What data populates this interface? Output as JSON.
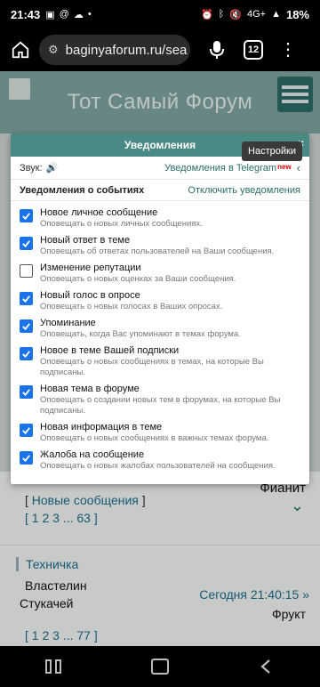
{
  "status": {
    "time": "21:43",
    "battery": "18%",
    "net": "4G+"
  },
  "browser": {
    "url": "baginyaforum.ru/sea",
    "tab_count": "12"
  },
  "forum": {
    "title": "Тот Самый Форум"
  },
  "popup": {
    "title": "Уведомления",
    "close": "×",
    "tooltip": "Настройки",
    "sound_label": "Звук:",
    "telegram_link": "Уведомления в Telegram",
    "new_badge": "new",
    "section_title": "Уведомления о событиях",
    "disable_link": "Отключить уведомления",
    "items": [
      {
        "title": "Новое личное сообщение",
        "desc": "Оповещать о новых личных сообщениях.",
        "checked": true
      },
      {
        "title": "Новый ответ в теме",
        "desc": "Оповещать об ответах пользователей на Ваши сообщения.",
        "checked": true
      },
      {
        "title": "Изменение репутации",
        "desc": "Оповещать о новых оценках за Ваши сообщения.",
        "checked": false
      },
      {
        "title": "Новый голос в опросе",
        "desc": "Оповещать о новых голосах в Ваших опросах.",
        "checked": true
      },
      {
        "title": "Упоминание",
        "desc": "Оповещать, когда Вас упоминают в темах форума.",
        "checked": true
      },
      {
        "title": "Новое в теме Вашей подписки",
        "desc": "Оповещать о новых сообщениях в темах, на которые Вы подписаны.",
        "checked": true
      },
      {
        "title": "Новая тема в форуме",
        "desc": "Оповещать о создании новых тем в форумах, на которые Вы подписаны.",
        "checked": true
      },
      {
        "title": "Новая информация в теме",
        "desc": "Оповещать о новых сообщениях в важных темах форума.",
        "checked": true
      },
      {
        "title": "Жалоба на сообщение",
        "desc": "Оповещать о новых жалобах пользователей на сообщения.",
        "checked": true
      }
    ]
  },
  "background": {
    "new_messages_open": "[",
    "new_messages": "Новые сообщения",
    "new_messages_close": "]",
    "pages1": "[ 1 2 3 ... 63 ]",
    "fianit": "Фианит",
    "category": "Техничка",
    "author1": "Властелин",
    "author2": "Стукачей",
    "today": "Сегодня 21:40:15 »",
    "last_user": "Фрукт",
    "pages2": "[ 1 2 3 ... 77 ]"
  }
}
